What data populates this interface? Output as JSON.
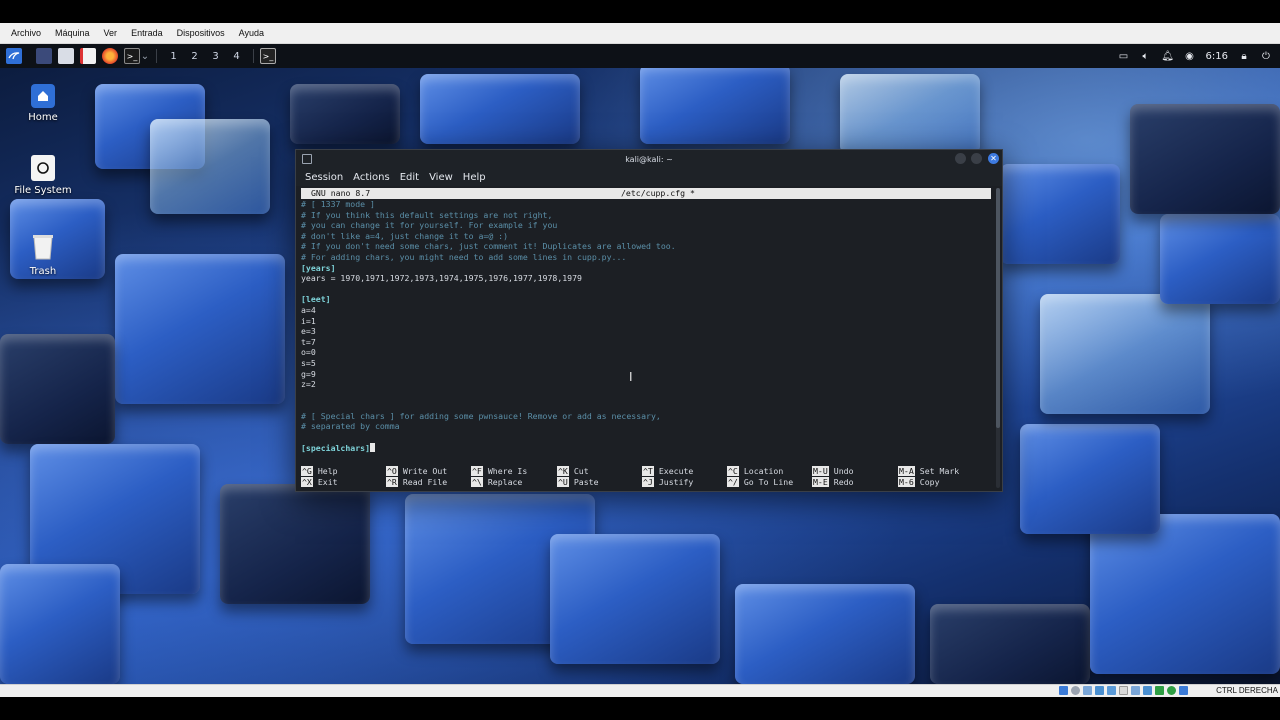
{
  "vbox_menu": [
    "Archivo",
    "Máquina",
    "Ver",
    "Entrada",
    "Dispositivos",
    "Ayuda"
  ],
  "taskbar": {
    "workspaces": [
      "1",
      "2",
      "3",
      "4"
    ],
    "clock": "6:16"
  },
  "desktop_icons": [
    {
      "label": "Home",
      "icon": "home-icon"
    },
    {
      "label": "File System",
      "icon": "drive-icon"
    },
    {
      "label": "Trash",
      "icon": "trash-icon"
    }
  ],
  "terminal": {
    "title": "kali@kali: ~",
    "menu": [
      "Session",
      "Actions",
      "Edit",
      "View",
      "Help"
    ],
    "nano_version": "GNU nano 8.7",
    "file_name": "/etc/cupp.cfg *",
    "lines": [
      {
        "text": "# [ 1337 mode ]",
        "kind": "cmt"
      },
      {
        "text": "# If you think this default settings are not right,",
        "kind": "cmt"
      },
      {
        "text": "# you can change it for yourself. For example if you",
        "kind": "cmt"
      },
      {
        "text": "# don't like a=4, just change it to a=@ :)",
        "kind": "cmt"
      },
      {
        "text": "# If you don't need some chars, just comment it! Duplicates are allowed too.",
        "kind": "cmt"
      },
      {
        "text": "# For adding chars, you might need to add some lines in cupp.py...",
        "kind": "cmt"
      },
      {
        "text": "[years]",
        "kind": "sect"
      },
      {
        "text": "years = 1970,1971,1972,1973,1974,1975,1976,1977,1978,1979",
        "kind": "plain"
      },
      {
        "text": "",
        "kind": "plain"
      },
      {
        "text": "[leet]",
        "kind": "sect"
      },
      {
        "text": "a=4",
        "kind": "plain"
      },
      {
        "text": "i=1",
        "kind": "plain"
      },
      {
        "text": "e=3",
        "kind": "plain"
      },
      {
        "text": "t=7",
        "kind": "plain"
      },
      {
        "text": "o=0",
        "kind": "plain"
      },
      {
        "text": "s=5",
        "kind": "plain"
      },
      {
        "text": "g=9",
        "kind": "plain"
      },
      {
        "text": "z=2",
        "kind": "plain"
      },
      {
        "text": "",
        "kind": "plain"
      },
      {
        "text": "",
        "kind": "plain"
      },
      {
        "text": "# [ Special chars ] for adding some pwnsauce! Remove or add as necessary,",
        "kind": "cmt"
      },
      {
        "text": "# separated by comma",
        "kind": "cmt"
      },
      {
        "text": "",
        "kind": "plain"
      },
      {
        "text": "[specialchars]",
        "kind": "sect",
        "cursor": true
      }
    ],
    "shortcuts": [
      {
        "k1": "^G",
        "l1": "Help",
        "k2": "^X",
        "l2": "Exit"
      },
      {
        "k1": "^O",
        "l1": "Write Out",
        "k2": "^R",
        "l2": "Read File"
      },
      {
        "k1": "^F",
        "l1": "Where Is",
        "k2": "^\\",
        "l2": "Replace"
      },
      {
        "k1": "^K",
        "l1": "Cut",
        "k2": "^U",
        "l2": "Paste"
      },
      {
        "k1": "^T",
        "l1": "Execute",
        "k2": "^J",
        "l2": "Justify"
      },
      {
        "k1": "^C",
        "l1": "Location",
        "k2": "^/",
        "l2": "Go To Line"
      },
      {
        "k1": "M-U",
        "l1": "Undo",
        "k2": "M-E",
        "l2": "Redo"
      },
      {
        "k1": "M-A",
        "l1": "Set Mark",
        "k2": "M-6",
        "l2": "Copy"
      }
    ]
  },
  "status_bar": {
    "host_key": "CTRL DERECHA"
  }
}
